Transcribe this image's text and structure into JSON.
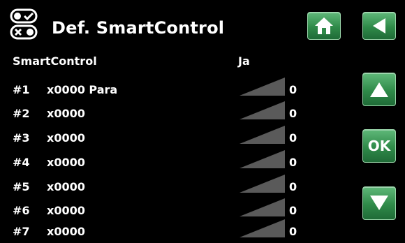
{
  "header": {
    "title": "Def. SmartControl",
    "icon": "smartcontrol-toggle-icon"
  },
  "columns": {
    "name": "SmartControl",
    "value": "Ja"
  },
  "buttons": {
    "home_icon": "home-icon",
    "back_icon": "back-arrow-icon",
    "up_icon": "up-arrow-icon",
    "ok_label": "OK",
    "down_icon": "down-arrow-icon"
  },
  "colors": {
    "button_green": "#2f8a49",
    "background": "#000000",
    "ramp_gray": "#5a5a5a"
  },
  "rows": [
    {
      "num": "#1",
      "code": "x0000 Para",
      "value": "0"
    },
    {
      "num": "#2",
      "code": "x0000",
      "value": "0"
    },
    {
      "num": "#3",
      "code": "x0000",
      "value": "0"
    },
    {
      "num": "#4",
      "code": "x0000",
      "value": "0"
    },
    {
      "num": "#5",
      "code": "x0000",
      "value": "0"
    },
    {
      "num": "#6",
      "code": "x0000",
      "value": "0"
    },
    {
      "num": "#7",
      "code": "x0000",
      "value": "0"
    }
  ]
}
